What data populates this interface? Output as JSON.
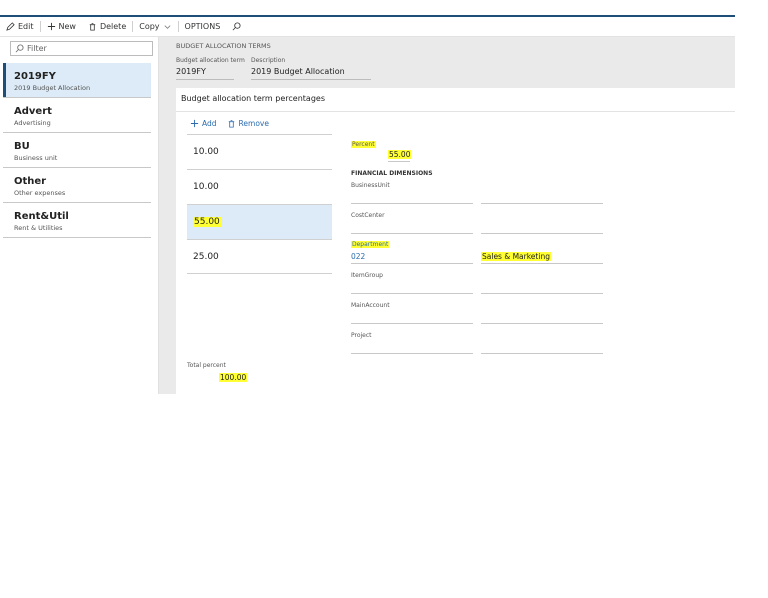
{
  "toolbar": {
    "edit": "Edit",
    "new": "New",
    "delete": "Delete",
    "copy": "Copy",
    "options": "OPTIONS"
  },
  "filter": {
    "placeholder": "Filter"
  },
  "list": [
    {
      "title": "2019FY",
      "subtitle": "2019 Budget Allocation"
    },
    {
      "title": "Advert",
      "subtitle": "Advertising"
    },
    {
      "title": "BU",
      "subtitle": "Business unit"
    },
    {
      "title": "Other",
      "subtitle": "Other expenses"
    },
    {
      "title": "Rent&Util",
      "subtitle": "Rent & Utilities"
    }
  ],
  "header": {
    "caption": "BUDGET ALLOCATION TERMS",
    "term_label": "Budget allocation term",
    "desc_label": "Description",
    "term_value": "2019FY",
    "desc_value": "2019 Budget Allocation"
  },
  "card": {
    "title": "Budget allocation term percentages",
    "add": "Add",
    "remove": "Remove",
    "rows": [
      "10.00",
      "10.00",
      "55.00",
      "25.00"
    ],
    "total_label": "Total percent",
    "total_value": "100.00"
  },
  "detail": {
    "percent_label": "Percent",
    "percent_value": "55.00",
    "section": "FINANCIAL DIMENSIONS",
    "business_unit": "BusinessUnit",
    "cost_center": "CostCenter",
    "department": "Department",
    "department_value": "022",
    "department_name": "Sales & Marketing",
    "item_group": "ItemGroup",
    "main_account": "MainAccount",
    "project": "Project"
  },
  "colors": {
    "accent": "#1f4e79",
    "highlight": "#ffff33",
    "link": "#2b6cb0"
  }
}
